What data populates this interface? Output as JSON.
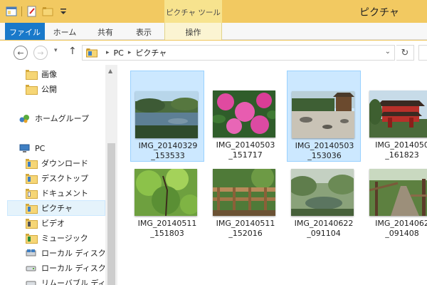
{
  "window": {
    "title": "ピクチャ",
    "contextual_group": "ピクチャ ツール"
  },
  "ribbon": {
    "tabs": [
      {
        "label": "ファイル"
      },
      {
        "label": "ホーム"
      },
      {
        "label": "共有"
      },
      {
        "label": "表示"
      },
      {
        "label": "操作"
      }
    ]
  },
  "address_bar": {
    "segments": [
      "PC",
      "ピクチャ"
    ]
  },
  "nav_pane": {
    "items": [
      {
        "label": "画像",
        "icon": "folder-icon"
      },
      {
        "label": "公開",
        "icon": "folder-icon"
      },
      {
        "label": "ホームグループ",
        "icon": "homegroup-icon"
      },
      {
        "label": "PC",
        "icon": "computer-icon"
      },
      {
        "label": "ダウンロード",
        "icon": "downloads-folder-icon"
      },
      {
        "label": "デスクトップ",
        "icon": "desktop-folder-icon"
      },
      {
        "label": "ドキュメント",
        "icon": "documents-folder-icon"
      },
      {
        "label": "ピクチャ",
        "icon": "pictures-folder-icon",
        "selected": true
      },
      {
        "label": "ビデオ",
        "icon": "videos-folder-icon"
      },
      {
        "label": "ミュージック",
        "icon": "music-folder-icon"
      },
      {
        "label": "ローカル ディスク (C",
        "icon": "local-disk-icon"
      },
      {
        "label": "ローカル ディスク (E",
        "icon": "disk-drive-icon"
      },
      {
        "label": "リムーバブル ディスク",
        "icon": "removable-disk-icon"
      }
    ]
  },
  "files": [
    {
      "name_line1": "IMG_20140329",
      "name_line2": "_153533",
      "selected": true,
      "scene": "pond-landscape"
    },
    {
      "name_line1": "IMG_20140503",
      "name_line2": "_151717",
      "selected": false,
      "scene": "pink-azaleas"
    },
    {
      "name_line1": "IMG_20140503",
      "name_line2": "_153036",
      "selected": true,
      "scene": "rock-garden"
    },
    {
      "name_line1": "IMG_2014050",
      "name_line2": "_161823",
      "selected": false,
      "scene": "red-temple"
    },
    {
      "name_line1": "IMG_20140511",
      "name_line2": "_151803",
      "selected": false,
      "scene": "green-canopy"
    },
    {
      "name_line1": "IMG_20140511",
      "name_line2": "_152016",
      "selected": false,
      "scene": "wooden-bridge"
    },
    {
      "name_line1": "IMG_20140622",
      "name_line2": "_091104",
      "selected": false,
      "scene": "misty-pond"
    },
    {
      "name_line1": "IMG_2014062",
      "name_line2": "_091408",
      "selected": false,
      "scene": "forest-path"
    }
  ],
  "colors": {
    "title_bar": "#f2c961",
    "file_tab": "#1979ca",
    "selection": "#cce8ff",
    "selection_border": "#99d1ff"
  }
}
